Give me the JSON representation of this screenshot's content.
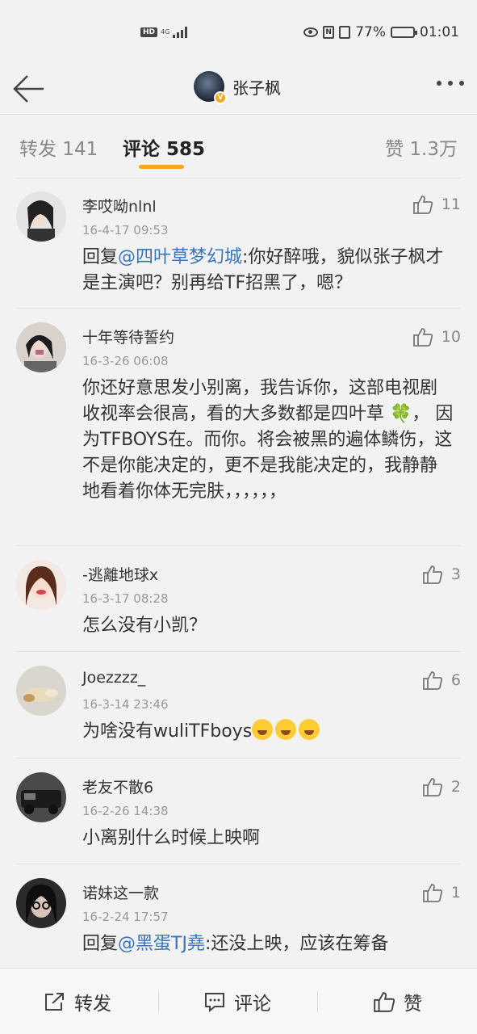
{
  "status_bar": {
    "network_badge": "HD",
    "network_type": "4G",
    "battery_percent": "77%",
    "time": "01:01",
    "battery_level": 0.77
  },
  "header": {
    "title": "张子枫",
    "verified_badge": "V",
    "back_icon": "back-arrow-icon",
    "more_icon": "more-dots-icon"
  },
  "tabs": [
    {
      "label": "转发 141"
    },
    {
      "label": "评论 585"
    },
    {
      "label": "赞 1.3万"
    }
  ],
  "active_tab": 1,
  "comments": [
    {
      "name": "李哎呦nlnl",
      "time": "16-4-17 09:53",
      "likes": "11",
      "prefix": "回复",
      "mention": "@四叶草梦幻城",
      "text": ":你好醉哦，貌似张子枫才是主演吧？别再给TF招黑了，嗯？",
      "avatar_color": "#d8d8d8"
    },
    {
      "name": "十年等待誓约",
      "time": "16-3-26 06:08",
      "likes": "10",
      "text": "你还好意思发小别离，我告诉你，这部电视剧收视率会很高，看的大多数都是四叶草 🍀， 因为TFBOYS在。而你。将会被黑的遍体鳞伤，这不是你能决定的，更不是我能决定的，我静静地看着你体无完肤，，，，，，",
      "avatar_color": "#c9b8b0"
    },
    {
      "name": "-逃離地球x",
      "time": "16-3-17 08:28",
      "likes": "3",
      "text": "怎么没有小凯？",
      "avatar_color": "#e8b9a6"
    },
    {
      "name": "Joezzzz_",
      "time": "16-3-14 23:46",
      "likes": "6",
      "text": "为啥没有wuliTFboys",
      "emoji_count": 3,
      "avatar_color": "#cdbfa8"
    },
    {
      "name": "老友不散6",
      "time": "16-2-26 14:38",
      "likes": "2",
      "text": "小离别什么时候上映啊",
      "avatar_color": "#3a3a3a"
    },
    {
      "name": "诺妹这一款",
      "time": "16-2-24 17:57",
      "likes": "1",
      "prefix": "回复",
      "mention": "@黑蛋TJ堯",
      "text": ":还没上映，应该在筹备",
      "avatar_color": "#2a2a2a"
    }
  ],
  "bottom_bar": {
    "repost": "转发",
    "comment": "评论",
    "like": "赞"
  }
}
